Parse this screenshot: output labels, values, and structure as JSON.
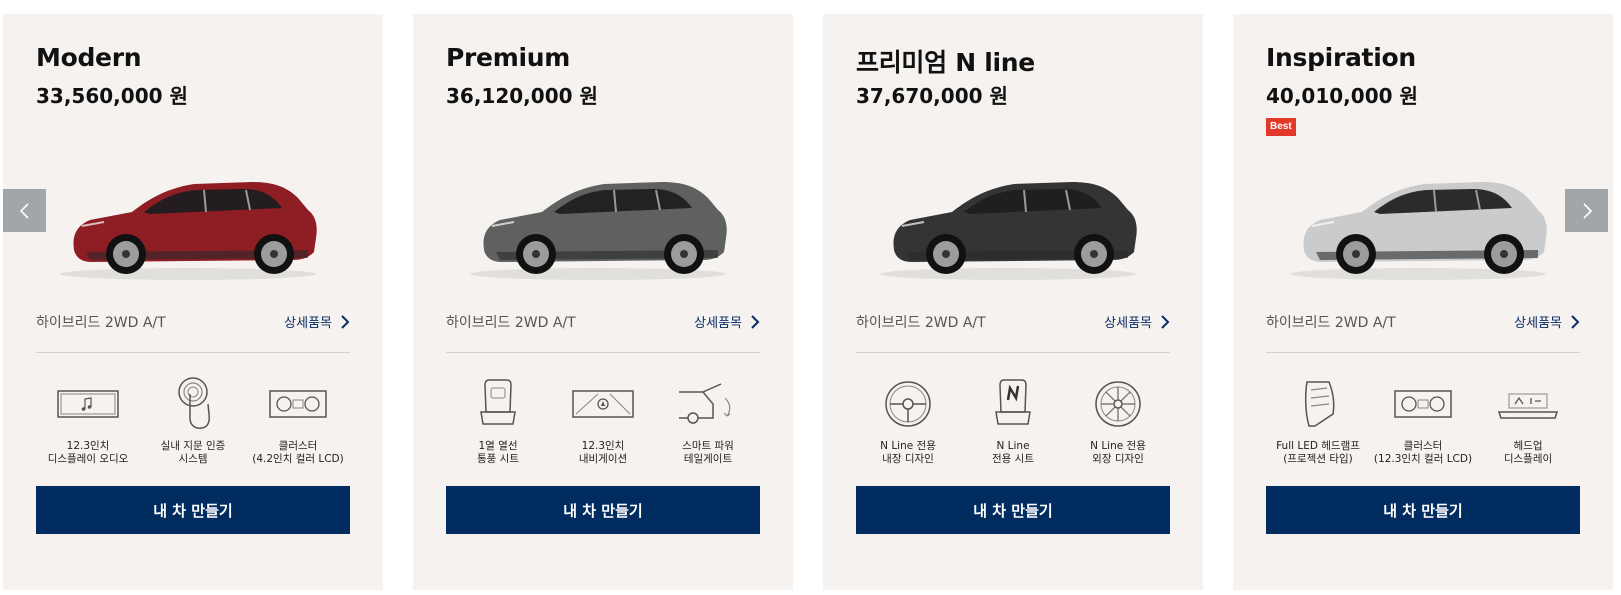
{
  "carousel": {
    "prev_icon": "chevron-left-icon",
    "next_icon": "chevron-right-icon"
  },
  "trims": [
    {
      "name": "Modern",
      "price": "33,560,000 원",
      "badge": "",
      "car_color": "#8e1d24",
      "engine": "하이브리드 2WD A/T",
      "detail_label": "상세품목",
      "features": [
        {
          "icon": "display-audio-icon",
          "label": "12.3인치\n디스플레이 오디오"
        },
        {
          "icon": "fingerprint-icon",
          "label": "실내 지문 인증\n시스템"
        },
        {
          "icon": "cluster-icon",
          "label": "클러스터\n(4.2인치 컬러 LCD)"
        }
      ],
      "cta": "내 차 만들기"
    },
    {
      "name": "Premium",
      "price": "36,120,000 원",
      "badge": "",
      "car_color": "#5e615f",
      "engine": "하이브리드 2WD A/T",
      "detail_label": "상세품목",
      "features": [
        {
          "icon": "heated-seat-icon",
          "label": "1열 열선\n통풍 시트"
        },
        {
          "icon": "navigation-icon",
          "label": "12.3인치\n내비게이션"
        },
        {
          "icon": "power-tailgate-icon",
          "label": "스마트 파워\n테일게이트"
        }
      ],
      "cta": "내 차 만들기"
    },
    {
      "name": "프리미엄 N line",
      "price": "37,670,000 원",
      "badge": "",
      "car_color": "#333436",
      "engine": "하이브리드 2WD A/T",
      "detail_label": "상세품목",
      "features": [
        {
          "icon": "steering-wheel-icon",
          "label": "N Line 전용\n내장 디자인"
        },
        {
          "icon": "n-seat-icon",
          "label": "N Line\n전용 시트"
        },
        {
          "icon": "wheel-icon",
          "label": "N Line 전용\n외장 디자인"
        }
      ],
      "cta": "내 차 만들기"
    },
    {
      "name": "Inspiration",
      "price": "40,010,000 원",
      "badge": "Best",
      "car_color": "#c9cbcc",
      "engine": "하이브리드 2WD A/T",
      "detail_label": "상세품목",
      "features": [
        {
          "icon": "led-headlamp-icon",
          "label": "Full LED 헤드램프\n(프로젝션 타입)"
        },
        {
          "icon": "cluster-icon",
          "label": "클러스터\n(12.3인치 컬러 LCD)"
        },
        {
          "icon": "head-up-display-icon",
          "label": "헤드업\n디스플레이"
        }
      ],
      "cta": "내 차 만들기"
    }
  ],
  "colors": {
    "card_bg": "#f5f2ef",
    "cta_bg": "#002c5f",
    "link": "#0b2d66",
    "badge": "#e2382a",
    "arrow_bg": "#a2a6ab"
  }
}
